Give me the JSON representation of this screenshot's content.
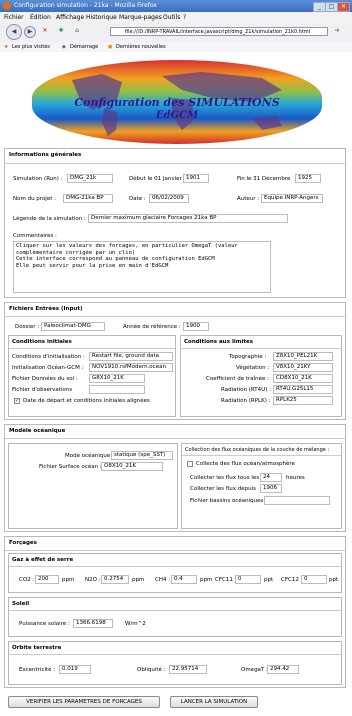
{
  "window": {
    "title": "Configuration simulation - 21ka - Mozilla Firefox",
    "controls": [
      "_",
      "□",
      "✕"
    ]
  },
  "menu": [
    "Fichier",
    "Édition",
    "Affichage",
    "Historique",
    "Marque-pages",
    "Outils",
    "?"
  ],
  "address_bar": {
    "url": "file:///D:/INRP-TRAVAIL/interface.javascript/dmg_21k/simulation_21k0.html"
  },
  "bookmarks": [
    "Les plus visités",
    "Démarrage",
    "Dernières nouvelles"
  ],
  "banner": {
    "title_line1": "Configuration des SIMULATIONS",
    "title_line2": "EdGCM"
  },
  "general": {
    "section_title": "Informations générales",
    "simulation_label": "Simulation (Run) :",
    "simulation_value": "DMG_21k",
    "start_label": "Début le 01 Janvier",
    "start_value": "1901",
    "end_label": "Fin le 31 Décembre",
    "end_value": "1925",
    "project_label": "Nom du projet :",
    "project_value": "DMG-21ka BP",
    "date_label": "Date :",
    "date_value": "06/02/2009",
    "author_label": "Auteur :",
    "author_value": "Equipe INRP-Angers",
    "legend_label": "Légende de la simulation :",
    "legend_value": "Dernier maximum glaciaire Forcages 21ka BP",
    "comments_label": "Commentaires :",
    "comments_value": "Cliquer sur les valeurs des forcages, en particulier OmegaT (valeur\ncomplémentaire corrigée par un clio)\nCette interface correspond au panneau de configuration EdGCM\nElle peut servir pour la prise en main d'EdGCM"
  },
  "input_files": {
    "section_title": "Fichiers Entrées (Input)",
    "folder_label": "Dossier :",
    "folder_value": "Paleoclimat-DMG",
    "ref_year_label": "Année de référence :",
    "ref_year_value": "1900",
    "initial": {
      "title": "Conditions initiales",
      "init_label": "Conditions d'initialisation :",
      "init_value": "Restart file, ground data",
      "ocean_label": "Initialisation Océan-GCM :",
      "ocean_value": "NOV1910.rsfModern.ocean",
      "soil_label": "Fichier Données du sol :",
      "soil_value": "G8X10_21K",
      "obs_label": "Fichier d'observations",
      "obs_value": "",
      "aligned_label": "Date de départ et conditions initiales alignées",
      "aligned_checked": true
    },
    "limits": {
      "title": "Conditions aux limites",
      "topo_label": "Topographie :",
      "topo_value": "Z8X10_PEL21K",
      "veg_label": "Végétation :",
      "veg_value": "V8X10_21KY",
      "drag_label": "Coefficient de traînée :",
      "drag_value": "CD8X10_21K",
      "rt4u_label": "Radiation (RT4U) :",
      "rt4u_value": "RT4U.G25L15",
      "rplk_label": "Radiation (RPLK) :",
      "rplk_value": "RPLK25"
    }
  },
  "ocean": {
    "section_title": "Modèle océanique",
    "mode_label": "Mode océanique :",
    "mode_value": "statique (spe_SST)",
    "surface_label": "Fichier Surface océan :",
    "surface_value": "O8X10_21K",
    "flux_title": "Collection des flux océaniques de la couche de mélange :",
    "flux_collect_label": "Collecte des flux océan/atmosphère",
    "flux_collect_checked": false,
    "flux_every_label": "Collecter les flux tous les",
    "flux_every_value": "24",
    "flux_every_unit": "heures",
    "flux_since_label": "Collecter les flux depuis",
    "flux_since_value": "1906",
    "basins_label": "Fichier bassins océaniques :",
    "basins_value": ""
  },
  "forcings": {
    "section_title": "Forçages",
    "ghg_title": "Gaz à effet de serre",
    "co2_label": "CO2 :",
    "co2_value": "200",
    "co2_unit": "ppm",
    "n2o_label": "N2O :",
    "n2o_value": "0.2754",
    "n2o_unit": "ppm",
    "ch4_label": "CH4 :",
    "ch4_value": "0.4",
    "ch4_unit": "ppm",
    "cfc11_label": "CFC11 :",
    "cfc11_value": "0",
    "cfc11_unit": "ppt",
    "cfc12_label": "CFC12 :",
    "cfc12_value": "0",
    "cfc12_unit": "ppt",
    "sun_title": "Soleil",
    "solar_label": "Puissance solaire :",
    "solar_value": "1366.6198",
    "solar_unit": "W/m^2",
    "orbit_title": "Orbite terrestre",
    "ecc_label": "Excentricité :",
    "ecc_value": "0.019",
    "obl_label": "Obliquité :",
    "obl_value": "22.95714",
    "omega_label": "OmegaT :",
    "omega_value": "294.42"
  },
  "buttons": {
    "verify": "VERIFIER LES PARAMETRES DE FORCAGES",
    "launch": "LANCER LA SIMULATION"
  }
}
